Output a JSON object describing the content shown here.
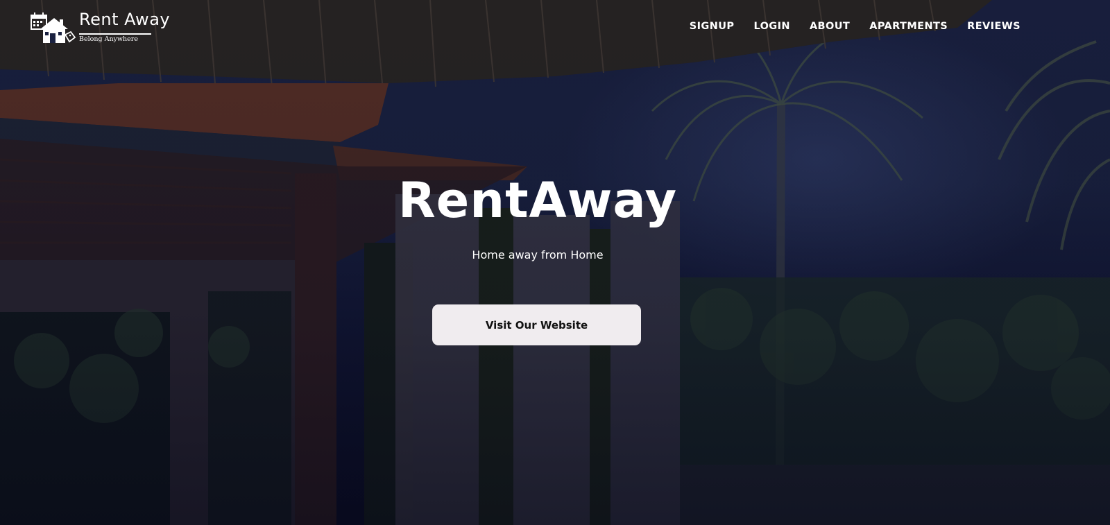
{
  "brand": {
    "name": "Rent Away",
    "tagline": "Belong Anywhere",
    "logo_icon": "house-calendar-tag-icon"
  },
  "nav": {
    "items": [
      {
        "label": "SIGNUP"
      },
      {
        "label": "LOGIN"
      },
      {
        "label": "ABOUT"
      },
      {
        "label": "APARTMENTS"
      },
      {
        "label": "REVIEWS"
      }
    ]
  },
  "hero": {
    "title": "RentAway",
    "subtitle": "Home away from Home",
    "cta_label": "Visit Our Website",
    "background": "tropical-villa-palm-trees-night"
  },
  "colors": {
    "text": "#ffffff",
    "button_bg": "#f0ecef",
    "button_text": "#111111",
    "overlay": "#0a0d24"
  }
}
